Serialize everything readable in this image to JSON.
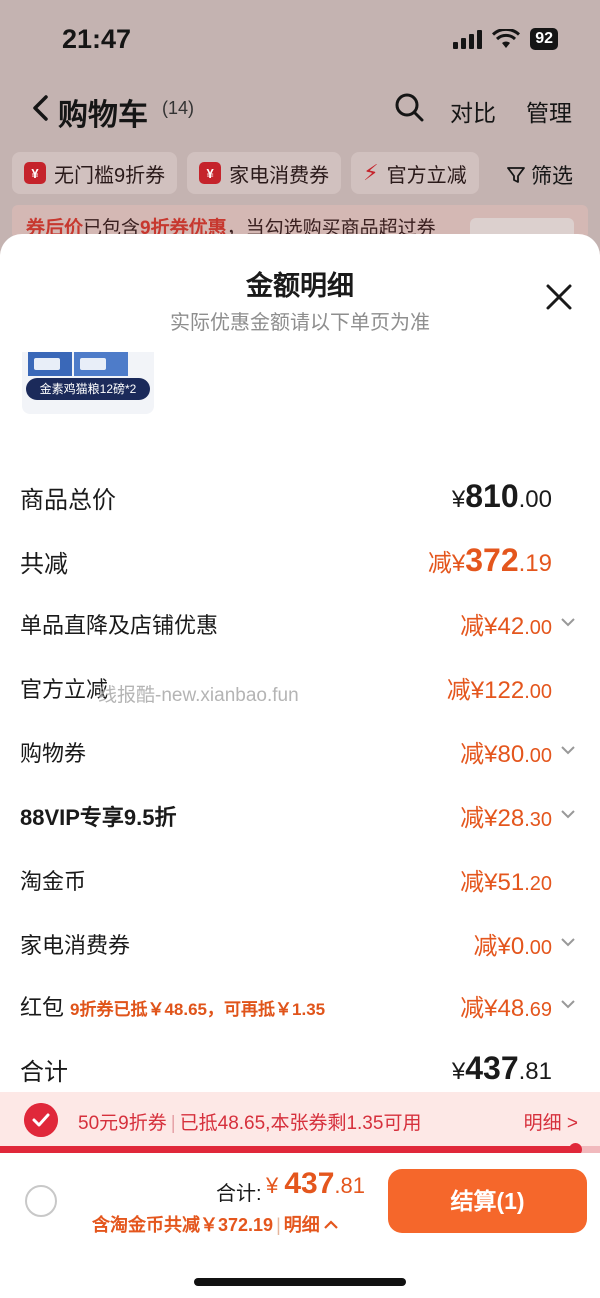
{
  "status_bar": {
    "time": "21:47",
    "battery": "92"
  },
  "nav": {
    "title": "购物车",
    "count": "(14)",
    "compare": "对比",
    "manage": "管理"
  },
  "chips": [
    {
      "icon": "¥",
      "label": "无门槛9折券"
    },
    {
      "icon": "¥",
      "label": "家电消费券"
    },
    {
      "icon": "bolt",
      "label": "官方立减"
    }
  ],
  "filter_label": "筛选",
  "promo_strip": {
    "highlight1": "券后价",
    "text1": "已包含",
    "highlight2": "9折券优惠",
    "text2": "，当勾选购买商品超过券"
  },
  "sheet": {
    "title": "金额明细",
    "subtitle": "实际优惠金额请以下单页为准",
    "product_label": "金素鸡猫粮12磅*2",
    "rows": [
      {
        "label": "商品总价",
        "prefix": "¥",
        "int": "810",
        "dec": ".00"
      },
      {
        "label": "共减",
        "prefix": "减¥",
        "int": "372",
        "dec": ".19"
      },
      {
        "label": "单品直降及店铺优惠",
        "prefix": "减¥",
        "int": "42",
        "dec": ".00"
      },
      {
        "label": "官方立减",
        "prefix": "减¥",
        "int": "122",
        "dec": ".00"
      },
      {
        "label": "购物券",
        "prefix": "减¥",
        "int": "80",
        "dec": ".00"
      },
      {
        "label": "88VIP专享9.5折",
        "prefix": "减¥",
        "int": "28",
        "dec": ".30"
      },
      {
        "label": "淘金币",
        "prefix": "减¥",
        "int": "51",
        "dec": ".20"
      },
      {
        "label": "家电消费券",
        "prefix": "减¥",
        "int": "0",
        "dec": ".00"
      },
      {
        "label": "红包",
        "note": "9折券已抵￥48.65，可再抵￥1.35",
        "prefix": "减¥",
        "int": "48",
        "dec": ".69"
      },
      {
        "label": "合计",
        "prefix": "¥",
        "int": "437",
        "dec": ".81"
      }
    ],
    "watermark": "线报酷-new.xianbao.fun"
  },
  "coupon_bar": {
    "name": "50元9折券",
    "status": "已抵48.65,本张券剩1.35可用",
    "detail": "明细 >",
    "progress": 0.96
  },
  "footer": {
    "total_label": "合计:",
    "total_prefix": "¥ ",
    "total_int": "437",
    "total_dec": ".81",
    "saving_text": "含淘金币共减￥372.19",
    "detail": "明细",
    "checkout_label": "结算(1)"
  },
  "colors": {
    "accent": "#e4561d",
    "coupon_red": "#e0283a",
    "checkout": "#f5672b"
  }
}
